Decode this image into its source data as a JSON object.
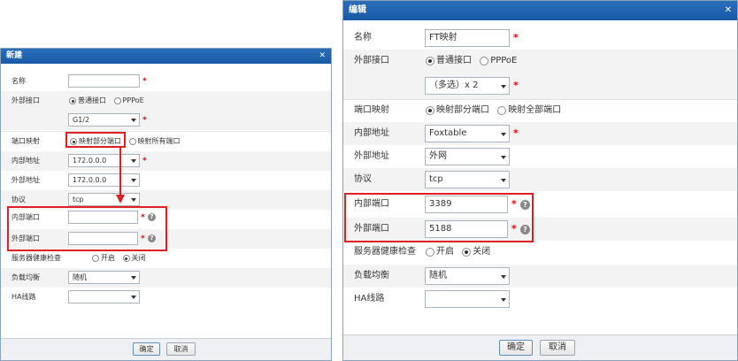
{
  "left": {
    "title": "新建",
    "close": "✕",
    "name_label": "名称",
    "name_value": "",
    "iface_label": "外部接口",
    "iface_opt1": "普通接口",
    "iface_opt2": "PPPoE",
    "iface_select": "G1/2",
    "portmap_label": "端口映射",
    "portmap_opt1": "映射部分端口",
    "portmap_opt2": "映射所有端口",
    "inner_addr_label": "内部地址",
    "inner_addr_value": "172.0.0.0",
    "outer_addr_label": "外部地址",
    "outer_addr_value": "172.0.0.0",
    "protocol_label": "协议",
    "protocol_value": "tcp",
    "inner_port_label": "内部端口",
    "inner_port_value": "",
    "outer_port_label": "外部端口",
    "outer_port_value": "",
    "health_label": "服务器健康检查",
    "health_on": "开启",
    "health_off": "关闭",
    "lb_label": "负载均衡",
    "lb_value": "随机",
    "ha_label": "HA线路",
    "ha_value": "",
    "ok": "确定",
    "cancel": "取消"
  },
  "right": {
    "title": "编辑",
    "close": "✕",
    "name_label": "名称",
    "name_value": "FT映射",
    "iface_label": "外部接口",
    "iface_opt1": "普通接口",
    "iface_opt2": "PPPoE",
    "iface_select": "（多选）x 2",
    "portmap_label": "端口映射",
    "portmap_opt1": "映射部分端口",
    "portmap_opt2": "映射全部端口",
    "inner_addr_label": "内部地址",
    "inner_addr_value": "Foxtable",
    "outer_addr_label": "外部地址",
    "outer_addr_value": "外网",
    "protocol_label": "协议",
    "protocol_value": "tcp",
    "inner_port_label": "内部端口",
    "inner_port_value": "3389",
    "outer_port_label": "外部端口",
    "outer_port_value": "5188",
    "health_label": "服务器健康检查",
    "health_on": "开启",
    "health_off": "关闭",
    "lb_label": "负载均衡",
    "lb_value": "随机",
    "ha_label": "HA线路",
    "ha_value": "",
    "ok": "确定",
    "cancel": "取消"
  },
  "req_mark": "*",
  "help_mark": "?",
  "colors": {
    "titlebar": "#1e63ae",
    "highlight": "#e02020",
    "required": "#e00000"
  }
}
